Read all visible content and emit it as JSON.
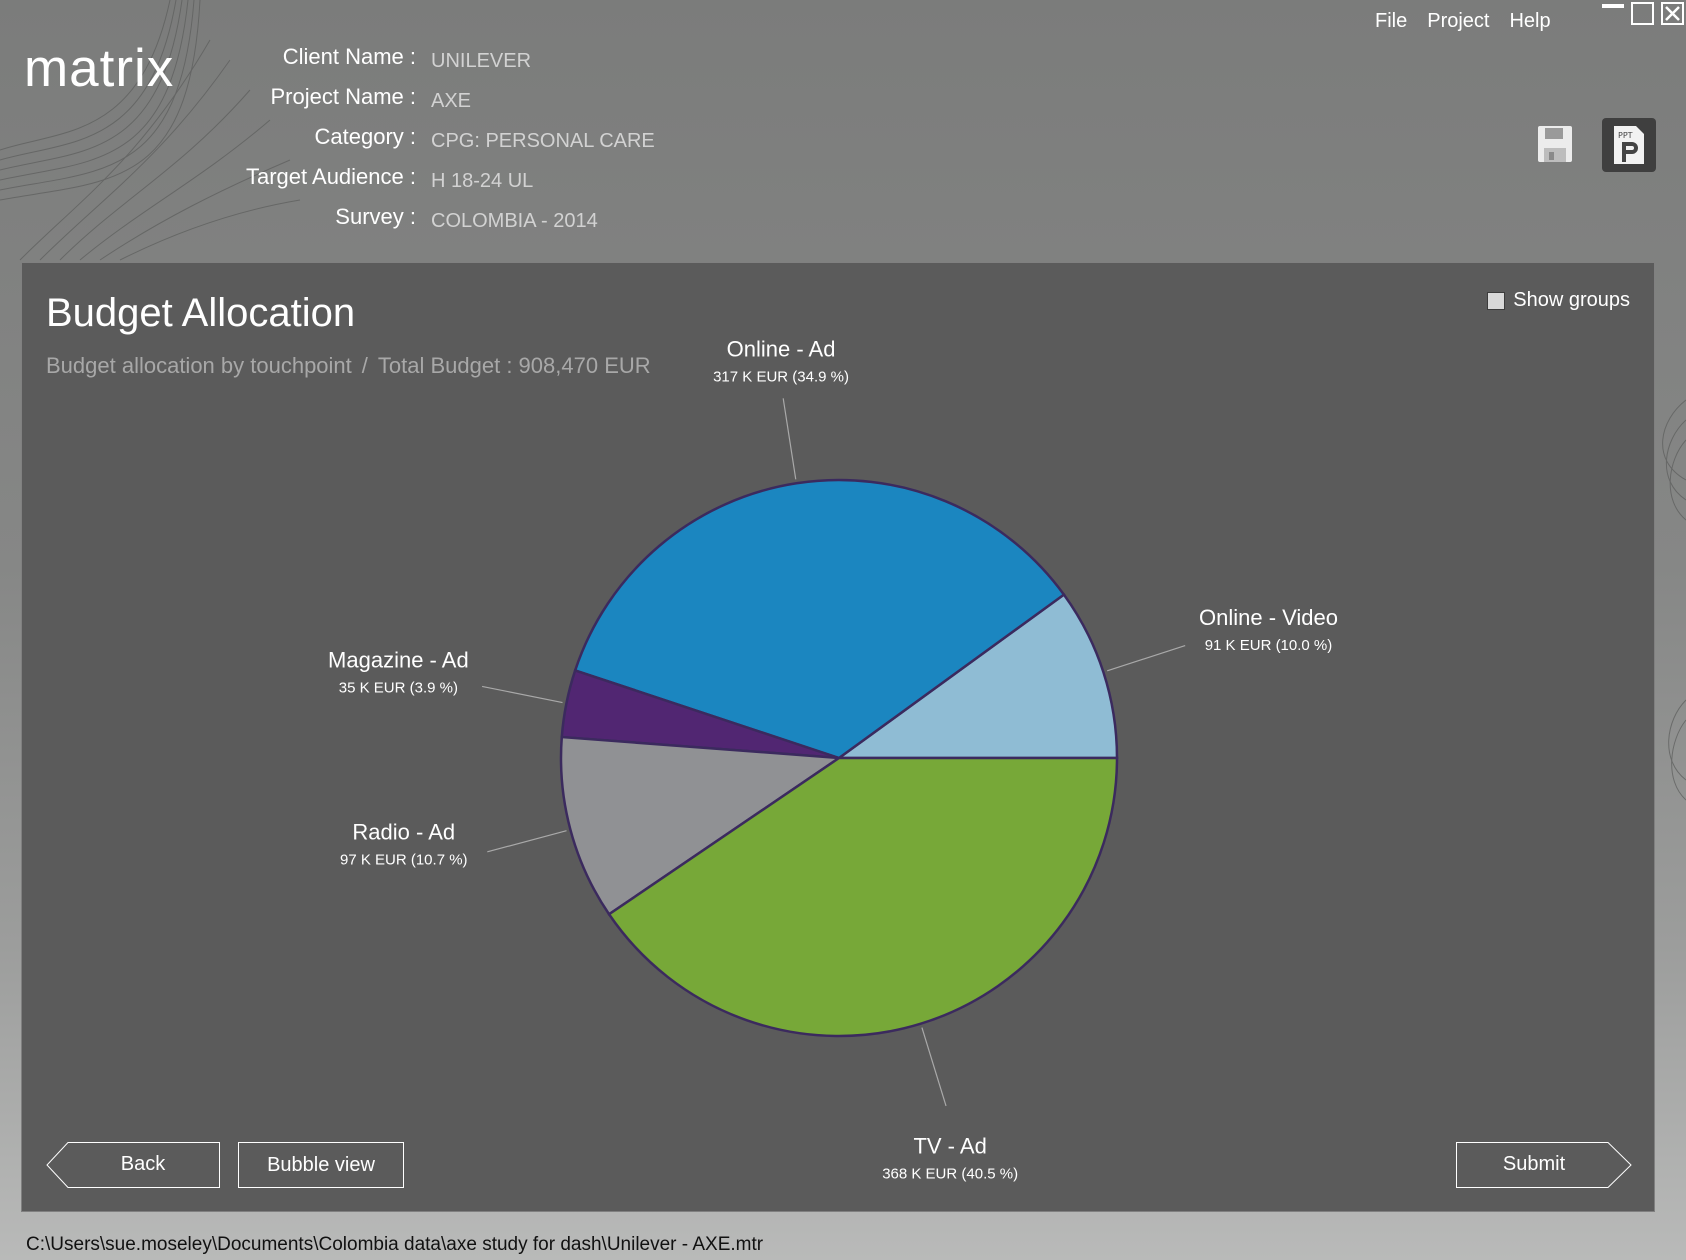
{
  "app": {
    "logo": "matrix"
  },
  "menu": {
    "items": [
      "File",
      "Project",
      "Help"
    ]
  },
  "project_info": [
    {
      "label": "Client Name :",
      "value": "UNILEVER"
    },
    {
      "label": "Project Name :",
      "value": "AXE"
    },
    {
      "label": "Category :",
      "value": "CPG: PERSONAL CARE"
    },
    {
      "label": "Target Audience :",
      "value": "H 18-24 UL"
    },
    {
      "label": "Survey :",
      "value": "COLOMBIA - 2014"
    }
  ],
  "toolbar": {
    "save_icon": "floppy-disk-icon",
    "export_icon": "powerpoint-export-icon"
  },
  "panel": {
    "title": "Budget Allocation",
    "subtitle_left": "Budget allocation by touchpoint",
    "subtitle_sep": "/",
    "subtitle_right": "Total Budget : 908,470 EUR",
    "show_groups_label": "Show groups",
    "show_groups_checked": false
  },
  "chart_data": {
    "type": "pie",
    "title": "Budget Allocation",
    "slices": [
      {
        "label": "Online - Video",
        "value_text": "91 K EUR (10.0 %)",
        "value": 91,
        "percent": 10.0,
        "color": "#8fbcd4"
      },
      {
        "label": "Online - Ad",
        "value_text": "317 K EUR (34.9 %)",
        "value": 317,
        "percent": 34.9,
        "color": "#1b86c0"
      },
      {
        "label": "Magazine - Ad",
        "value_text": "35 K EUR (3.9 %)",
        "value": 35,
        "percent": 3.9,
        "color": "#512672"
      },
      {
        "label": "Radio - Ad",
        "value_text": "97 K EUR (10.7 %)",
        "value": 97,
        "percent": 10.7,
        "color": "#909194"
      },
      {
        "label": "TV - Ad",
        "value_text": "368 K EUR (40.5 %)",
        "value": 368,
        "percent": 40.5,
        "color": "#77a838"
      }
    ],
    "start_angle": "3 o'clock",
    "direction": "counter-clockwise",
    "legend": "none"
  },
  "buttons": {
    "back": "Back",
    "bubble_view": "Bubble view",
    "submit": "Submit"
  },
  "status": {
    "file_path": "C:\\Users\\sue.moseley\\Documents\\Colombia data\\axe study for dash\\Unilever - AXE.mtr"
  }
}
